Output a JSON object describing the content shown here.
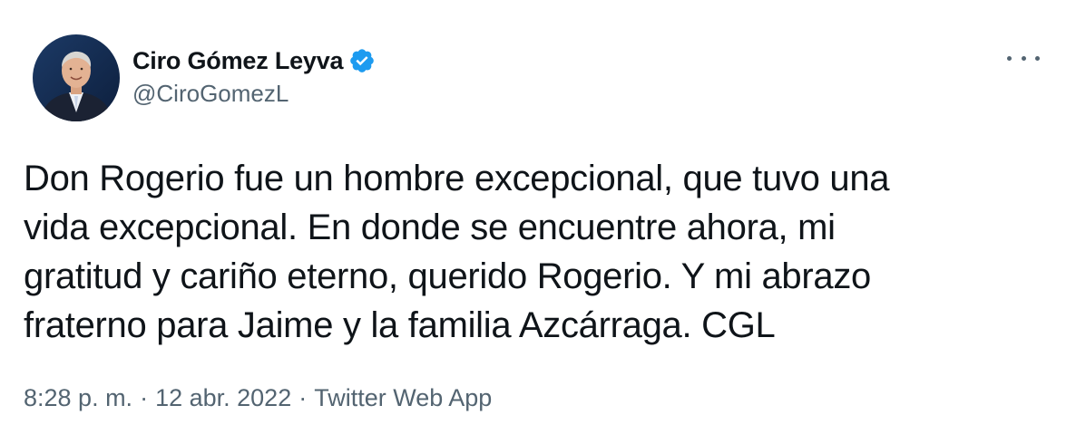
{
  "author": {
    "display_name": "Ciro Gómez Leyva",
    "handle": "@CiroGomezL",
    "verified_icon": "verified-badge-icon",
    "avatar": "profile-photo"
  },
  "menu": {
    "icon": "more-options-icon"
  },
  "tweet": {
    "lines": [
      "Don Rogerio fue un hombre excepcional, que tuvo una",
      "vida excepcional. En donde se encuentre ahora, mi",
      "gratitud y cariño eterno, querido Rogerio. Y mi abrazo",
      "fraterno para Jaime y la familia Azcárraga. CGL"
    ]
  },
  "meta": {
    "time": "8:28 p. m.",
    "separator": "·",
    "date": "12 abr. 2022",
    "source": "Twitter Web App"
  },
  "colors": {
    "text": "#0f1419",
    "secondary": "#536471",
    "verified": "#1d9bf0",
    "background": "#ffffff"
  }
}
